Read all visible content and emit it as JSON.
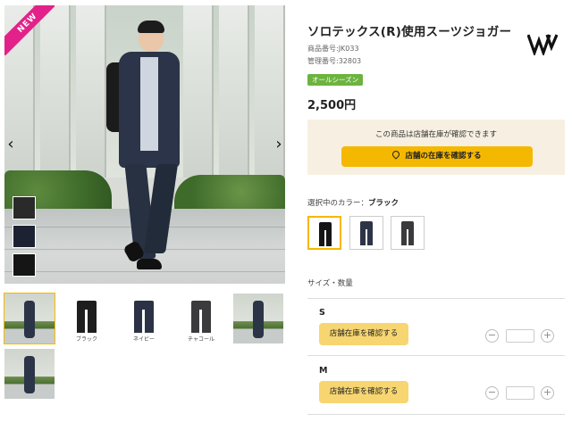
{
  "gallery": {
    "badge": "NEW",
    "prev_icon": "‹",
    "next_icon": "›",
    "thumbnails": [
      {
        "kind": "photo",
        "label": "",
        "selected": true
      },
      {
        "kind": "pants",
        "label": "ブラック",
        "color": "#1e1e1e"
      },
      {
        "kind": "pants",
        "label": "ネイビー",
        "color": "#2c3246"
      },
      {
        "kind": "pants",
        "label": "チャコール",
        "color": "#3b3b3d"
      },
      {
        "kind": "photo",
        "label": ""
      },
      {
        "kind": "photo",
        "label": ""
      }
    ]
  },
  "product": {
    "title": "ソロテックス(R)使用スーツジョガー",
    "product_number": "商品番号:JK033",
    "management_number": "管理番号:32803",
    "season_tag": "オールシーズン",
    "price": "2,500円",
    "brand_logo": "W"
  },
  "stock": {
    "message": "この商品は店舗在庫が確認できます",
    "button_label": "店舗の在庫を確認する"
  },
  "color_select": {
    "label_prefix": "選択中のカラー：",
    "selected_name": "ブラック",
    "options": [
      {
        "color": "#151515",
        "selected": true
      },
      {
        "color": "#2d3447",
        "selected": false
      },
      {
        "color": "#3a3a3c",
        "selected": false
      }
    ]
  },
  "sizes": {
    "label": "サイズ・数量",
    "rows": [
      {
        "name": "S",
        "button_label": "店舗在庫を確認する",
        "minus": "−",
        "plus": "+",
        "qty": ""
      },
      {
        "name": "M",
        "button_label": "店舗在庫を確認する",
        "minus": "−",
        "plus": "+",
        "qty": ""
      }
    ]
  },
  "colors": {
    "accent": "#f5b800",
    "badge": "#e3218a",
    "season": "#6cb33f",
    "stock_bg": "#f7f0e2"
  }
}
